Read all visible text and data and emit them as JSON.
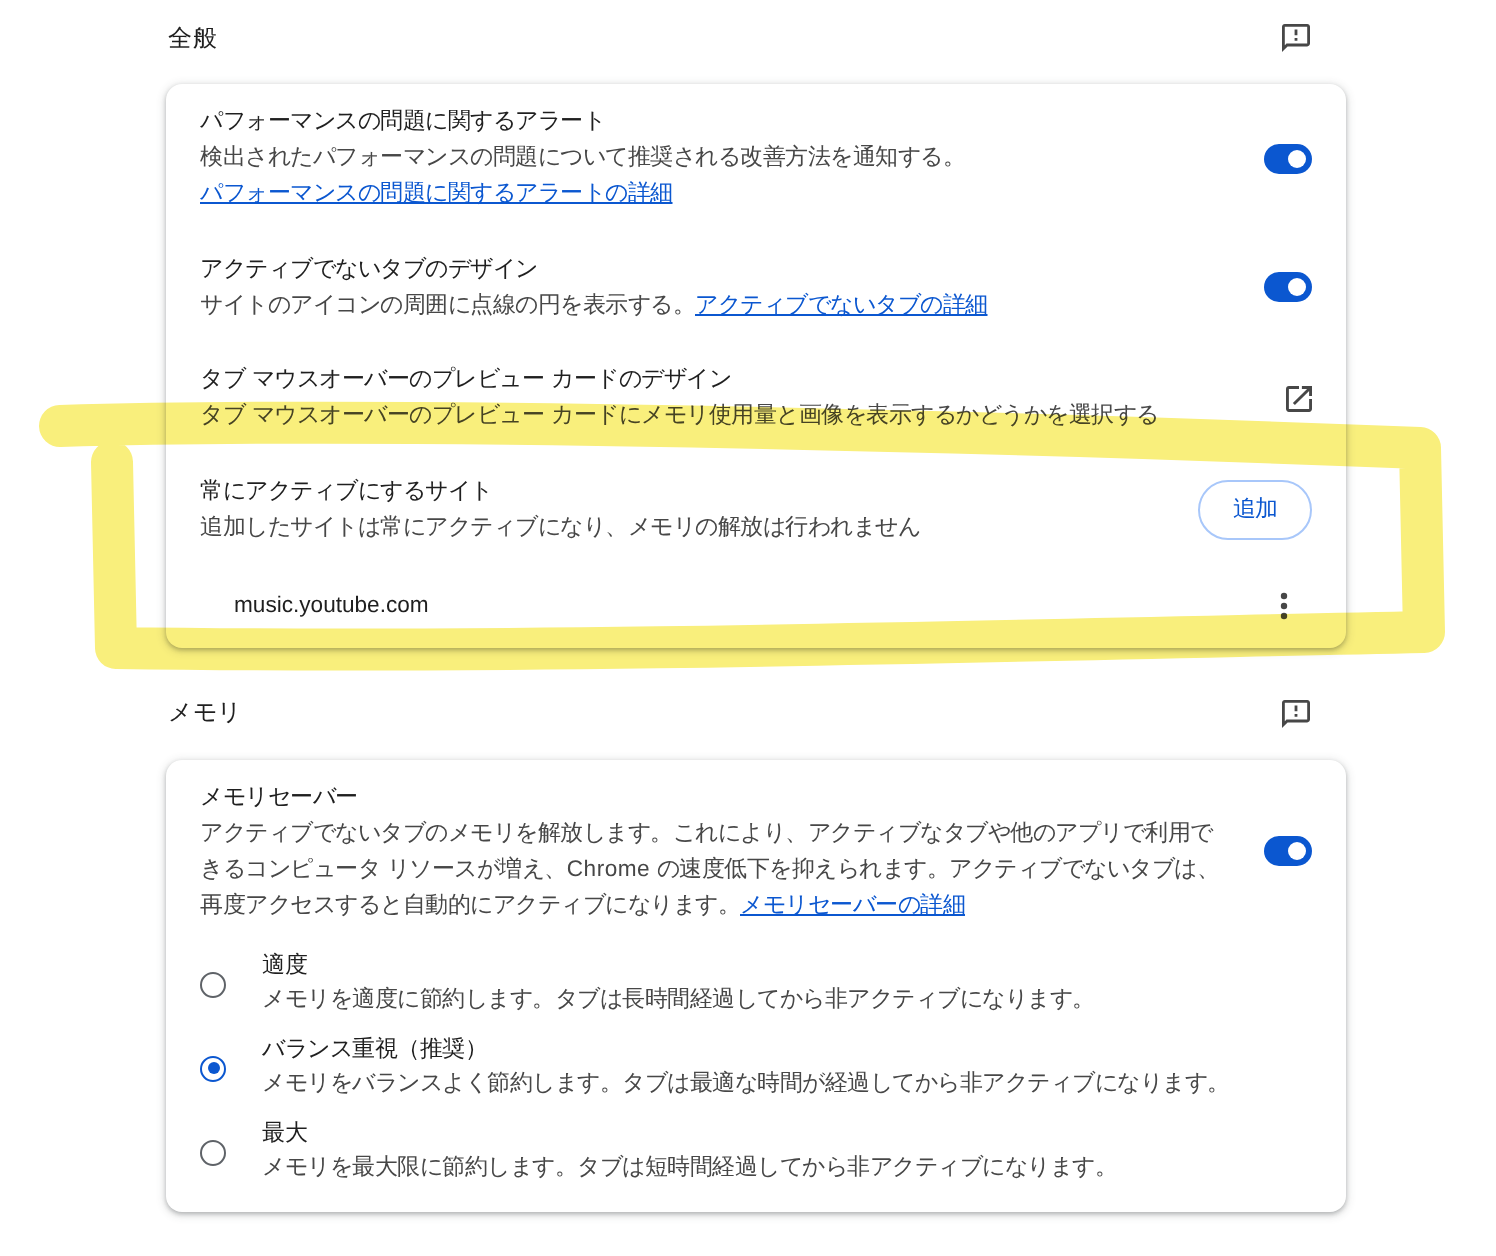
{
  "sections": [
    {
      "title": "全般",
      "card": {
        "rows": [
          {
            "kind": "toggle",
            "title": "パフォーマンスの問題に関するアラート",
            "description": "検出されたパフォーマンスの問題について推奨される改善方法を通知する。",
            "link": "パフォーマンスの問題に関するアラートの詳細",
            "on": true
          },
          {
            "kind": "toggle",
            "title": "アクティブでないタブのデザイン",
            "description": "サイトのアイコンの周囲に点線の円を表示する。",
            "link": "アクティブでないタブの詳細",
            "on": true
          },
          {
            "kind": "external",
            "title": "タブ マウスオーバーのプレビュー カードのデザイン",
            "description": "タブ マウスオーバーのプレビュー カードにメモリ使用量と画像を表示するかどうかを選択する"
          },
          {
            "kind": "button",
            "title": "常にアクティブにするサイト",
            "description": "追加したサイトは常にアクティブになり、メモリの解放は行われません",
            "button": "追加"
          },
          {
            "kind": "site",
            "site": "music.youtube.com"
          }
        ]
      }
    },
    {
      "title": "メモリ",
      "card": {
        "rows": [
          {
            "kind": "toggle",
            "title": "メモリセーバー",
            "description": "アクティブでないタブのメモリを解放します。これにより、アクティブなタブや他のアプリで利用できるコンピュータ リソースが増え、Chrome の速度低下を抑えられます。アクティブでないタブは、再度アクセスすると自動的にアクティブになります。",
            "link": "メモリセーバーの詳細",
            "on": true
          },
          {
            "kind": "radio",
            "title": "適度",
            "description": "メモリを適度に節約します。タブは長時間経過してから非アクティブになります。",
            "selected": false
          },
          {
            "kind": "radio",
            "title": "バランス重視（推奨）",
            "description": "メモリをバランスよく節約します。タブは最適な時間が経過してから非アクティブになります。",
            "selected": true
          },
          {
            "kind": "radio",
            "title": "最大",
            "description": "メモリを最大限に節約します。タブは短時間経過してから非アクティブになります。",
            "selected": false
          }
        ]
      }
    }
  ]
}
